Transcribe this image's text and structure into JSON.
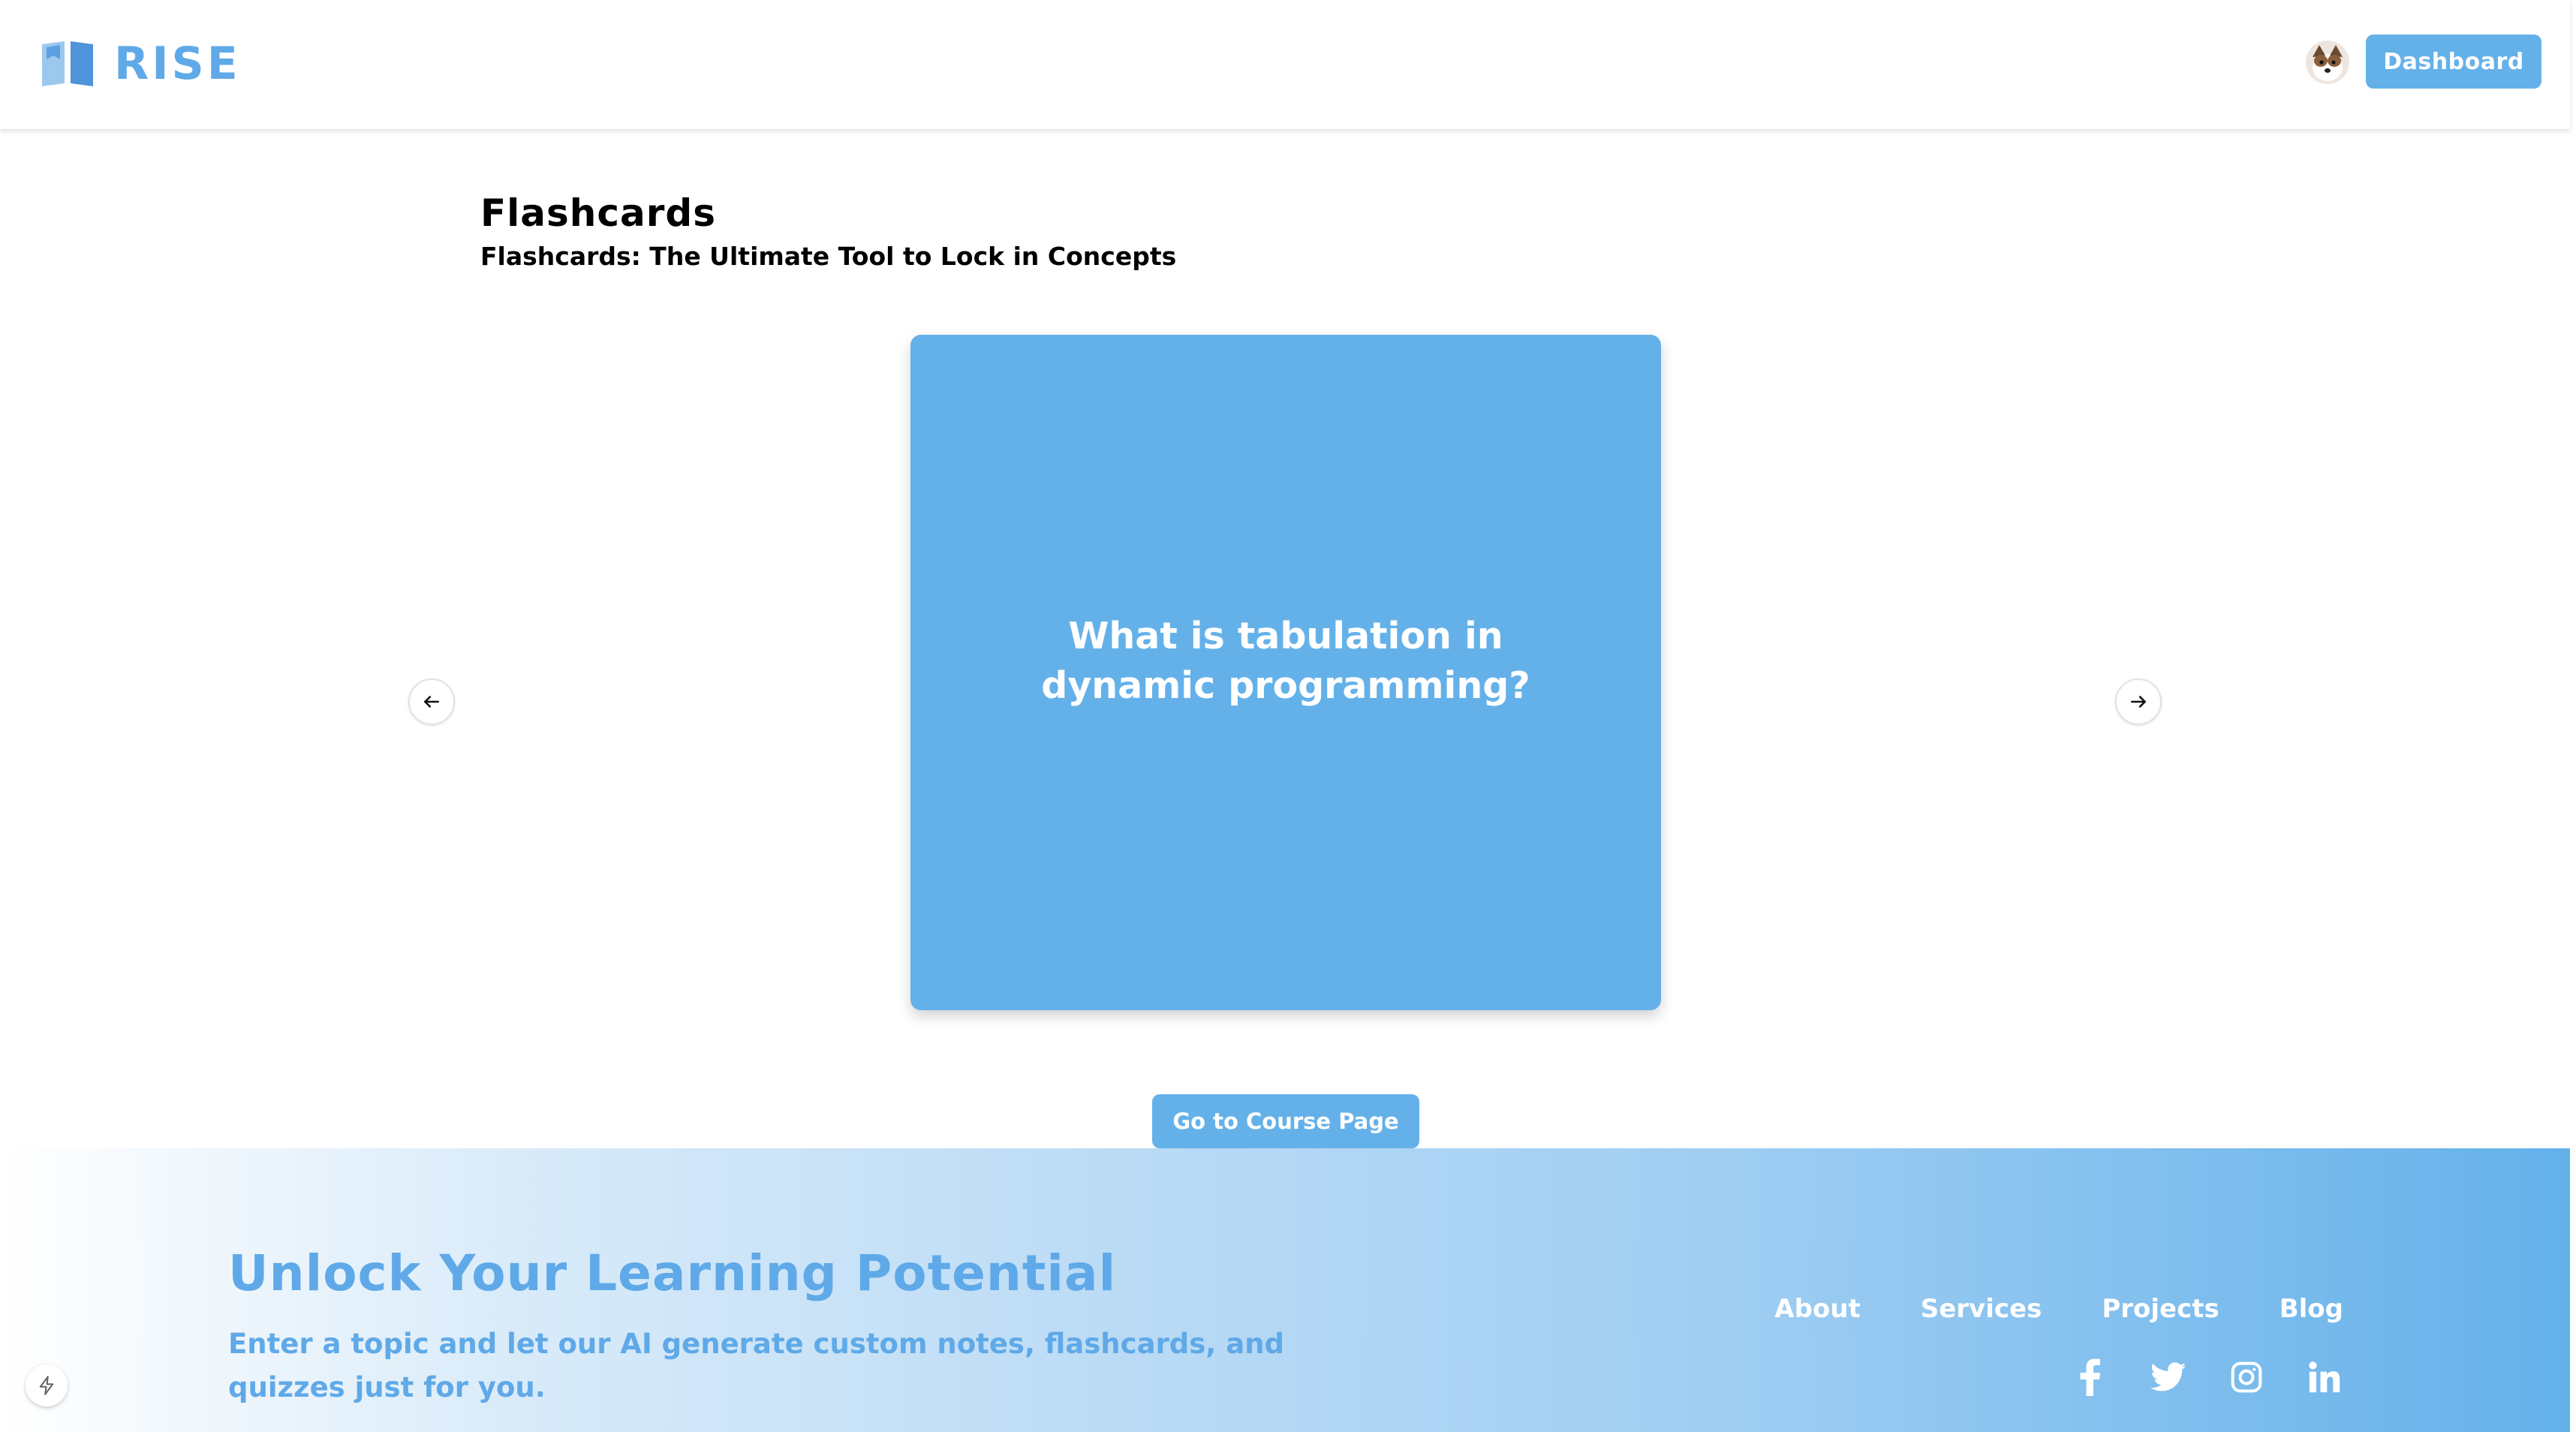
{
  "header": {
    "brand_name": "RISE",
    "dashboard_label": "Dashboard"
  },
  "main": {
    "title": "Flashcards",
    "subtitle": "Flashcards: The Ultimate Tool to Lock in Concepts",
    "card": {
      "question": "What is tabulation in dynamic programming?"
    },
    "course_button_label": "Go to Course Page"
  },
  "footer": {
    "title": "Unlock Your Learning Potential",
    "description": "Enter a topic and let our AI generate custom notes, flashcards, and quizzes just for you.",
    "nav": [
      "About",
      "Services",
      "Projects",
      "Blog"
    ],
    "socials": [
      "facebook-icon",
      "twitter-icon",
      "instagram-icon",
      "linkedin-icon"
    ]
  },
  "icons": {
    "logo": "open-book-icon",
    "prev": "arrow-left-icon",
    "next": "arrow-right-icon",
    "floating": "lightning-bolt-icon"
  },
  "colors": {
    "accent": "#64B1EA",
    "brand_text": "#5FA9E8",
    "text": "#000000",
    "white": "#ffffff"
  }
}
